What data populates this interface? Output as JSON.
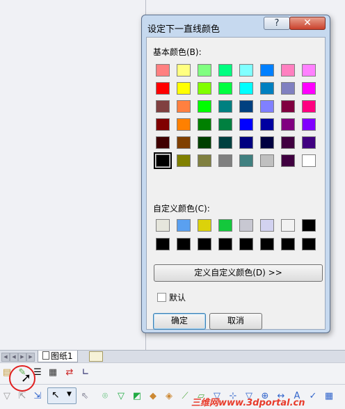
{
  "dialog": {
    "title": "设定下一直线颜色",
    "help_label": "?",
    "close_label": "✕",
    "basic_colors_label": "基本颜色(B):",
    "custom_colors_label": "自定义颜色(C):",
    "define_custom_button": "定义自定义颜色(D) >>",
    "default_checkbox_label": "默认",
    "default_checked": false,
    "ok_button": "确定",
    "cancel_button": "取消",
    "basic_colors": [
      [
        "#ff8080",
        "#ffff80",
        "#80ff80",
        "#00ff80",
        "#80ffff",
        "#0080ff",
        "#ff80c0",
        "#ff80ff"
      ],
      [
        "#ff0000",
        "#ffff00",
        "#80ff00",
        "#00ff40",
        "#00ffff",
        "#0080c0",
        "#8080c0",
        "#ff00ff"
      ],
      [
        "#804040",
        "#ff8040",
        "#00ff00",
        "#008080",
        "#004080",
        "#8080ff",
        "#800040",
        "#ff0080"
      ],
      [
        "#800000",
        "#ff8000",
        "#008000",
        "#008040",
        "#0000ff",
        "#0000a0",
        "#800080",
        "#8000ff"
      ],
      [
        "#400000",
        "#804000",
        "#004000",
        "#004040",
        "#000080",
        "#000040",
        "#400040",
        "#400080"
      ],
      [
        "#000000",
        "#808000",
        "#808040",
        "#808080",
        "#408080",
        "#c0c0c0",
        "#400040",
        "#ffffff"
      ]
    ],
    "selected_basic": [
      5,
      0
    ],
    "custom_colors": [
      [
        "#e6e6dc",
        "#5aa0f0",
        "#dcd20a",
        "#14c83c",
        "#c8c8d2",
        "#d2d2f0",
        "#f2f2f2",
        "#000000"
      ],
      [
        "#000000",
        "#000000",
        "#000000",
        "#000000",
        "#000000",
        "#000000",
        "#000000",
        "#000000"
      ]
    ]
  },
  "sheet_tab_label": "图纸1",
  "watermark": "三维网www.3dportal.cn"
}
